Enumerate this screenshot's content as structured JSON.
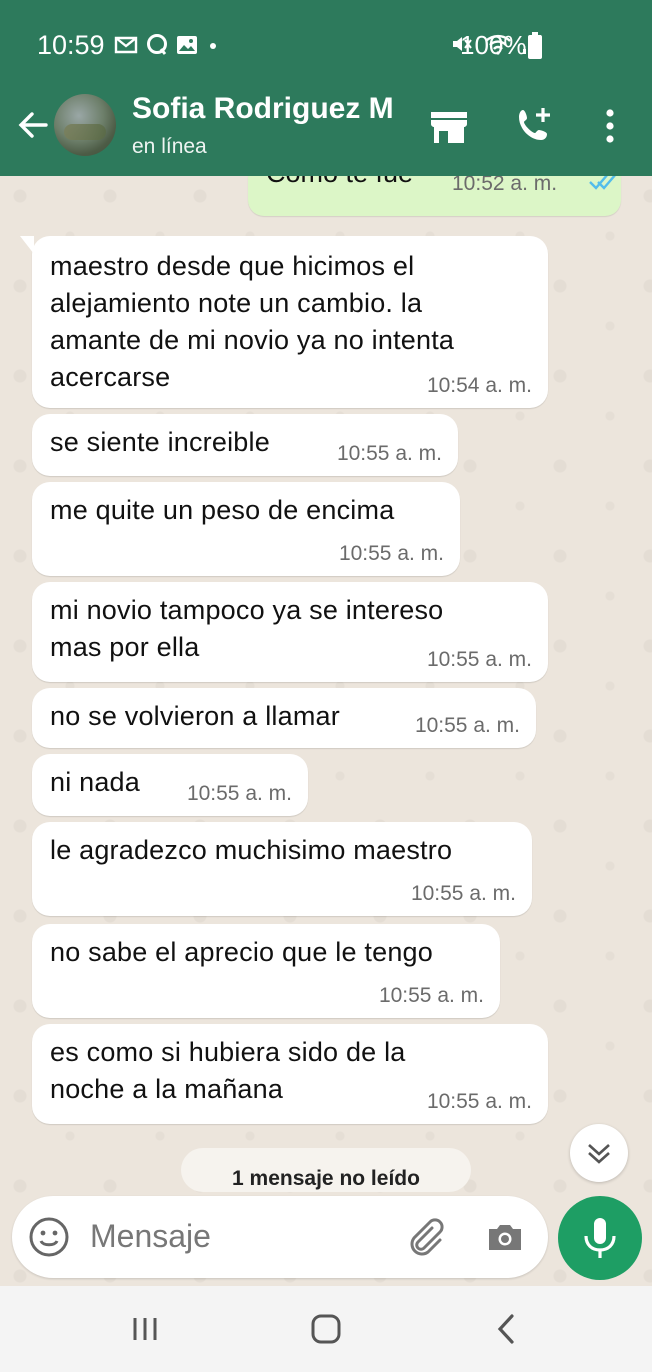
{
  "status_bar": {
    "time": "10:59",
    "battery": "100%",
    "icons": [
      "gmail-icon",
      "message-icon",
      "gallery-icon",
      "dot-icon",
      "mute-icon",
      "wifi-icon",
      "signal-icon",
      "battery-icon"
    ]
  },
  "header": {
    "contact_name": "Sofia Rodriguez M",
    "status": "en línea",
    "icons": [
      "back-arrow-icon",
      "store-icon",
      "add-call-icon",
      "more-vert-icon"
    ]
  },
  "chat": {
    "outgoing_partial": {
      "text": "Como te fue",
      "time": "10:52 a. m.",
      "read": true
    },
    "messages": [
      {
        "lines": [
          "maestro desde que hicimos el",
          "alejamiento note un cambio. la",
          "amante de mi novio ya no intenta",
          "acercarse"
        ],
        "time": "10:54 a. m."
      },
      {
        "lines": [
          "se siente increible"
        ],
        "time": "10:55 a. m."
      },
      {
        "lines": [
          "me quite un peso de encima"
        ],
        "time": "10:55 a. m."
      },
      {
        "lines": [
          "mi novio tampoco ya se intereso",
          "mas por ella"
        ],
        "time": "10:55 a. m."
      },
      {
        "lines": [
          "no se volvieron a llamar"
        ],
        "time": "10:55 a. m."
      },
      {
        "lines": [
          "ni nada"
        ],
        "time": "10:55 a. m."
      },
      {
        "lines": [
          "le agradezco muchisimo maestro"
        ],
        "time": "10:55 a. m."
      },
      {
        "lines": [
          "no sabe el aprecio que le tengo"
        ],
        "time": "10:55 a. m."
      },
      {
        "lines": [
          "es como si hubiera sido de la",
          "noche a la mañana"
        ],
        "time": "10:55 a. m."
      }
    ],
    "unread_label": "1 mensaje no leído"
  },
  "composer": {
    "placeholder": "Mensaje",
    "icons": [
      "emoji-icon",
      "attach-icon",
      "camera-icon",
      "mic-icon"
    ]
  },
  "nav_bar": {
    "icons": [
      "recents-icon",
      "home-icon",
      "back-icon"
    ]
  },
  "colors": {
    "header_bg": "#2d7a5c",
    "outgoing_bubble": "#dcf6c7",
    "incoming_bubble": "#ffffff",
    "mic_button": "#1e9e64",
    "read_ticks": "#53bdeb"
  }
}
